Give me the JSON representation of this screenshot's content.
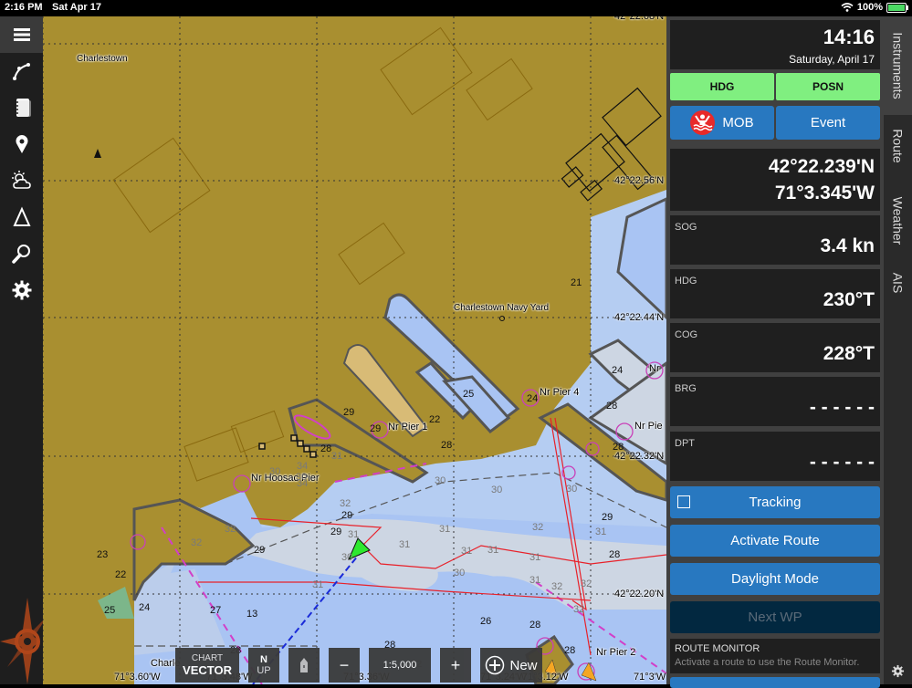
{
  "status_bar": {
    "time": "2:16 PM",
    "date": "Sat Apr 17",
    "battery": "100%"
  },
  "left_toolbar": [
    {
      "name": "menu-icon",
      "active": true
    },
    {
      "name": "route-icon"
    },
    {
      "name": "logbook-icon"
    },
    {
      "name": "marker-icon"
    },
    {
      "name": "weather-icon"
    },
    {
      "name": "tide-icon"
    },
    {
      "name": "search-icon"
    },
    {
      "name": "settings-icon"
    }
  ],
  "map": {
    "place_labels": [
      "Charlestown",
      "Charlestown Navy Yard",
      "Nr Hoosac Pier",
      "Nr Pier 1",
      "Nr Pier 4",
      "Nr Pie",
      "Nr",
      "Nr Pier 2",
      "Charle"
    ],
    "lat_labels": [
      "42°22.68'N",
      "42°22.56'N",
      "42°22.44'N",
      "42°22.32'N",
      "42°22.20'N"
    ],
    "lon_labels": [
      "71°3.60'W",
      "71°3.48'W",
      "71°3.36'W",
      "71°3.24'W",
      "71°3.12'W",
      "71°3'W"
    ],
    "soundings_black": [
      "29",
      "29",
      "22",
      "28",
      "28",
      "28",
      "25",
      "24",
      "21",
      "24",
      "28",
      "23",
      "22",
      "25",
      "29",
      "29",
      "29",
      "27",
      "28",
      "28",
      "26",
      "28",
      "28",
      "28",
      "24",
      "13",
      "29"
    ],
    "soundings_grey": [
      "31",
      "34",
      "30",
      "34",
      "32",
      "30",
      "30",
      "30",
      "30",
      "32",
      "31",
      "31",
      "31",
      "31",
      "31",
      "32",
      "31",
      "30",
      "31",
      "32",
      "31",
      "32",
      "30",
      "31",
      "32",
      "32",
      "32"
    ]
  },
  "bottom_bar": {
    "chart_small": "CHART",
    "chart_big": "VECTOR",
    "orient_top": "N",
    "orient_bottom": "UP",
    "zoom_out": "−",
    "scale": "1:5,000",
    "zoom_in": "+",
    "new_label": "New"
  },
  "panel": {
    "clock_time": "14:16",
    "clock_date": "Saturday, April 17",
    "hdg_button": "HDG",
    "posn_button": "POSN",
    "mob_button": "MOB",
    "event_button": "Event",
    "lat": "42°22.239'N",
    "lon": "71°3.345'W",
    "instruments": [
      {
        "label": "SOG",
        "value": "3.4 kn"
      },
      {
        "label": "HDG",
        "value": "230°T"
      },
      {
        "label": "COG",
        "value": "228°T"
      },
      {
        "label": "BRG",
        "value": "- - - - - -"
      },
      {
        "label": "DPT",
        "value": "- - - - - -"
      }
    ],
    "tracking_button": "Tracking",
    "tracking_checked": false,
    "activate_route_button": "Activate Route",
    "daylight_button": "Daylight Mode",
    "next_wp_button": "Next WP",
    "route_monitor_title": "ROUTE MONITOR",
    "route_monitor_desc": "Activate a route to use the Route Monitor."
  },
  "tabs": [
    "Instruments",
    "Route",
    "Weather",
    "AIS"
  ],
  "active_tab": "Instruments"
}
